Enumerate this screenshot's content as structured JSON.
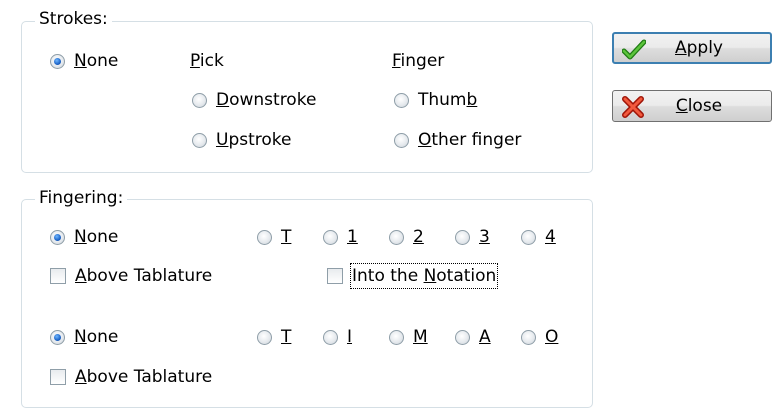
{
  "strokes": {
    "legend": "Strokes:",
    "none_label": "None",
    "pick": {
      "header": "Pick",
      "downstroke": "Downstroke",
      "upstroke": "Upstroke"
    },
    "finger": {
      "header": "Finger",
      "thumb": "Thumb",
      "other": "Other finger"
    }
  },
  "fingering": {
    "legend": "Fingering:",
    "left_hand": {
      "none_label": "None",
      "options": [
        "T",
        "1",
        "2",
        "3",
        "4"
      ],
      "above_label": "Above Tablature",
      "into_label": "Into the Notation"
    },
    "right_hand": {
      "none_label": "None",
      "options": [
        "T",
        "I",
        "M",
        "A",
        "O"
      ],
      "above_label": "Above Tablature"
    }
  },
  "buttons": {
    "apply_label": "Apply",
    "apply_icon": "check-icon",
    "close_label": "Close",
    "close_icon": "x-icon"
  },
  "colors": {
    "check_green": "#3fae2a",
    "close_red": "#e0301e",
    "default_border": "#3c7fb1",
    "radio_selected": "#1c64c8"
  }
}
